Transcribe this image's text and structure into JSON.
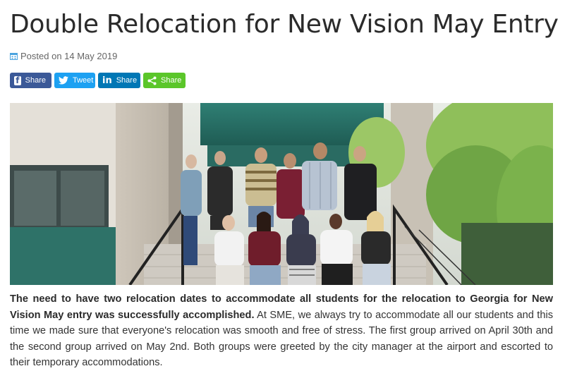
{
  "post": {
    "title": "Double Relocation for New Vision May Entry",
    "posted_label": "Posted on 14 May 2019"
  },
  "share_buttons": [
    {
      "label": "Share",
      "network": "facebook",
      "color": "#3b5998",
      "icon": "facebook-icon"
    },
    {
      "label": "Tweet",
      "network": "twitter",
      "color": "#1da1f2",
      "icon": "twitter-icon"
    },
    {
      "label": "Share",
      "network": "linkedin",
      "color": "#0077b5",
      "icon": "linkedin-icon"
    },
    {
      "label": "Share",
      "network": "share",
      "color": "#5bc62a",
      "icon": "share-icon"
    }
  ],
  "article": {
    "lead_bold": "The need to have two relocation dates to accommodate all students for the relocation to Georgia for New Vision May entry was successfully accomplished.",
    "body": " At SME, we always try to accommodate all our students and this time we made sure that everyone's relocation was smooth and free of stress. The first group arrived on April 30th and the second group arrived on May 2nd. Both groups were greeted by the city manager at the airport and escorted to their temporary accommodations."
  }
}
